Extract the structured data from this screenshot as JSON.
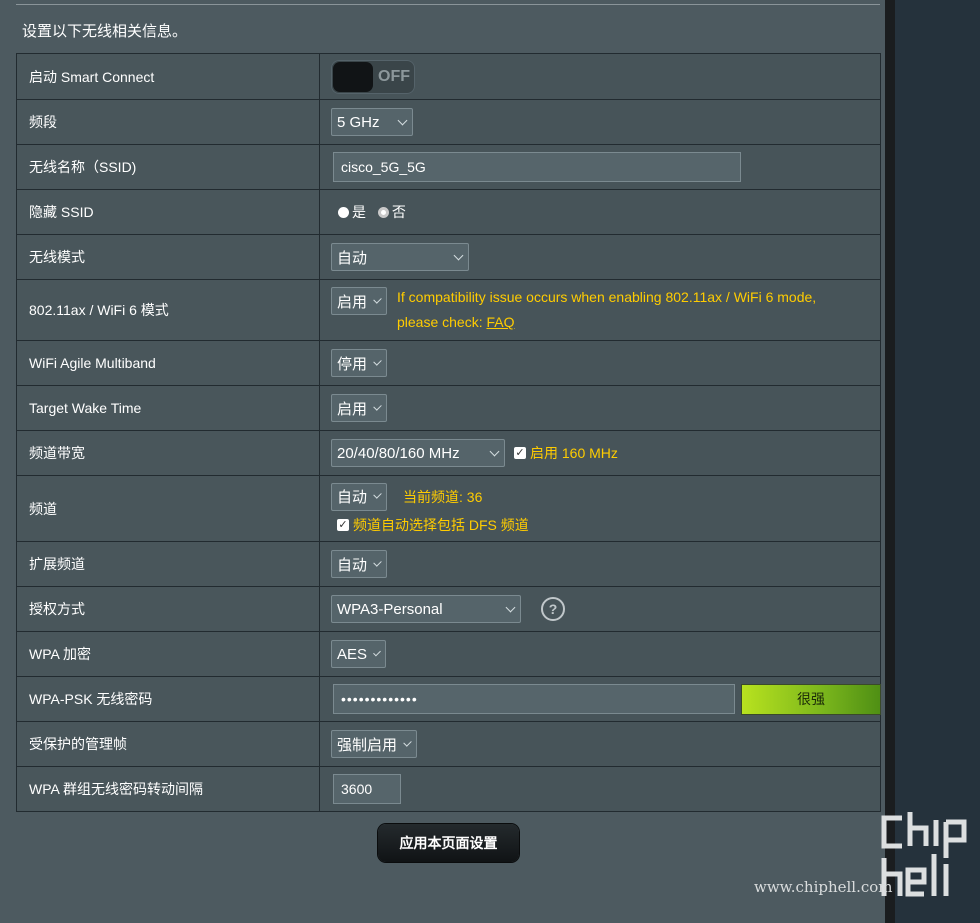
{
  "section_title": "设置以下无线相关信息。",
  "rows": {
    "smart_connect": {
      "label": "启动 Smart Connect",
      "toggle_text": "OFF"
    },
    "band": {
      "label": "频段",
      "value": "5 GHz"
    },
    "ssid": {
      "label": "无线名称（SSID)",
      "value": "cisco_5G_5G"
    },
    "hide_ssid": {
      "label": "隐藏 SSID",
      "opt_yes": "是",
      "opt_no": "否",
      "selected": "否"
    },
    "wireless_mode": {
      "label": "无线模式",
      "value": "自动"
    },
    "wifi6": {
      "label": "802.11ax / WiFi 6 模式",
      "value": "启用",
      "note_line1": "If compatibility issue occurs when enabling 802.11ax / WiFi 6 mode,",
      "note_line2_prefix": "please check: ",
      "note_link": "FAQ"
    },
    "agile_multiband": {
      "label": "WiFi Agile Multiband",
      "value": "停用"
    },
    "twt": {
      "label": "Target Wake Time",
      "value": "启用"
    },
    "bandwidth": {
      "label": "频道带宽",
      "value": "20/40/80/160 MHz",
      "checkbox_label": "启用 160 MHz"
    },
    "channel": {
      "label": "频道",
      "value": "自动",
      "current": "当前频道: 36",
      "dfs_label": "频道自动选择包括 DFS 频道"
    },
    "ext_channel": {
      "label": "扩展频道",
      "value": "自动"
    },
    "auth": {
      "label": "授权方式",
      "value": "WPA3-Personal",
      "help": "?"
    },
    "wpa_enc": {
      "label": "WPA 加密",
      "value": "AES"
    },
    "psk": {
      "label": "WPA-PSK 无线密码",
      "value": "•••••••••••••",
      "strength": "很强"
    },
    "pmf": {
      "label": "受保护的管理帧",
      "value": "强制启用"
    },
    "rekey": {
      "label": "WPA 群组无线密码转动间隔",
      "value": "3600"
    }
  },
  "apply_button": "应用本页面设置",
  "watermark": {
    "url": "www.chiphell.com"
  },
  "colors": {
    "page_bg": "#4d5a60",
    "amber": "#ffcc00",
    "strength_green": "#79b51c"
  }
}
